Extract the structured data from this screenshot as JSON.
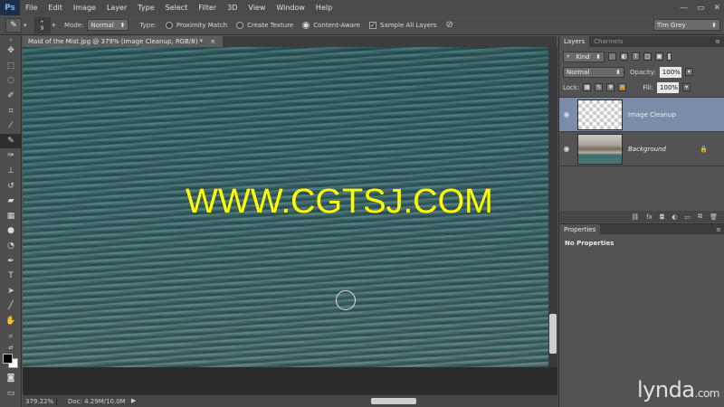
{
  "app": {
    "logo": "Ps",
    "window_controls": [
      "—",
      "▭",
      "✕"
    ]
  },
  "menu": [
    "File",
    "Edit",
    "Image",
    "Layer",
    "Type",
    "Select",
    "Filter",
    "3D",
    "View",
    "Window",
    "Help"
  ],
  "options": {
    "brush_size": "9",
    "mode_label": "Mode:",
    "mode_value": "Normal",
    "type_label": "Type:",
    "proximity_match": "Proximity Match",
    "create_texture": "Create Texture",
    "content_aware": "Content-Aware",
    "sample_all_layers": "Sample All Layers",
    "workspace": "Tim Grey"
  },
  "document": {
    "tab_title": "Maid of the Mist.jpg @ 379% (Image Cleanup, RGB/8) *",
    "tab_close": "×"
  },
  "watermark": "WWW.CGTSJ.COM",
  "status": {
    "zoom": "379.22%",
    "doc_size": "Doc: 4.29M/10.0M"
  },
  "layers_panel": {
    "tabs": [
      "Layers",
      "Channels"
    ],
    "kind_label": "Kind",
    "blend_mode": "Normal",
    "opacity_label": "Opacity:",
    "opacity_value": "100%",
    "lock_label": "Lock:",
    "fill_label": "Fill:",
    "fill_value": "100%",
    "layers": [
      {
        "name": "Image Cleanup",
        "selected": true
      },
      {
        "name": "Background",
        "selected": false
      }
    ]
  },
  "properties_panel": {
    "tab": "Properties",
    "message": "No Properties"
  },
  "branding": {
    "name": "lynda",
    "suffix": ".com"
  },
  "colors": {
    "accent_selected": "#7a8ca8",
    "watermark": "#ffff00",
    "water": "#42727a"
  }
}
